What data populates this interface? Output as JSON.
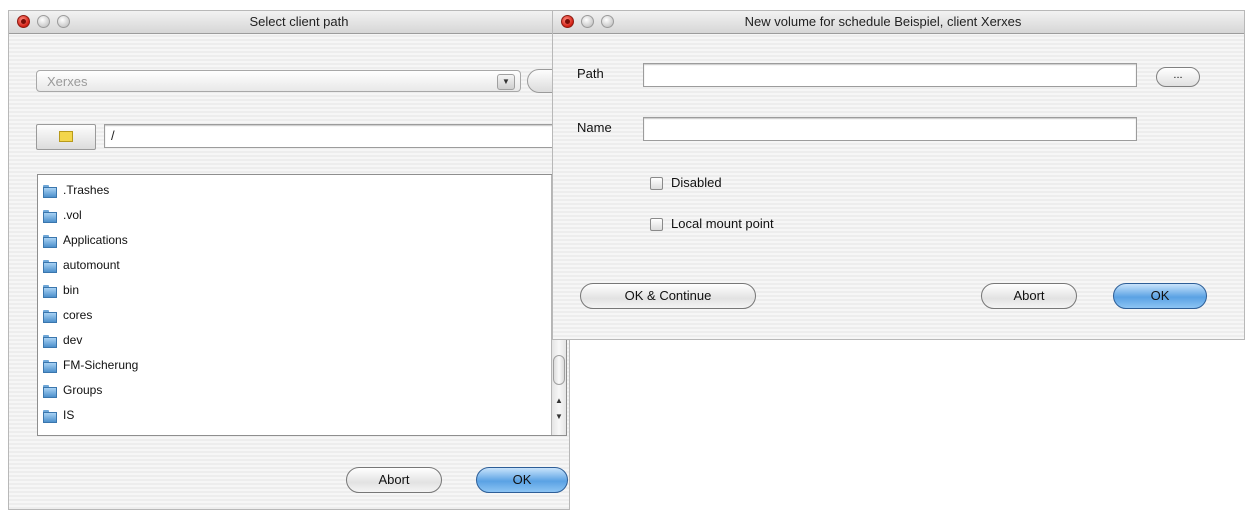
{
  "select_dialog": {
    "title": "Select client path",
    "client_popup": "Xerxes",
    "path_value": "/",
    "folders": [
      ".Trashes",
      ".vol",
      "Applications",
      "automount",
      "bin",
      "cores",
      "dev",
      "FM-Sicherung",
      "Groups",
      "IS"
    ],
    "abort_label": "Abort",
    "ok_label": "OK"
  },
  "volume_dialog": {
    "title": "New volume for schedule Beispiel, client Xerxes",
    "path_label": "Path",
    "path_value": "",
    "browse_label": "...",
    "name_label": "Name",
    "name_value": "",
    "disabled_label": "Disabled",
    "local_mount_label": "Local mount point",
    "ok_continue_label": "OK & Continue",
    "abort_label": "Abort",
    "ok_label": "OK"
  },
  "colors": {
    "default_button": "#5aa2e4",
    "close_button": "#d21e12",
    "folder_icon": "#4d90cc"
  }
}
